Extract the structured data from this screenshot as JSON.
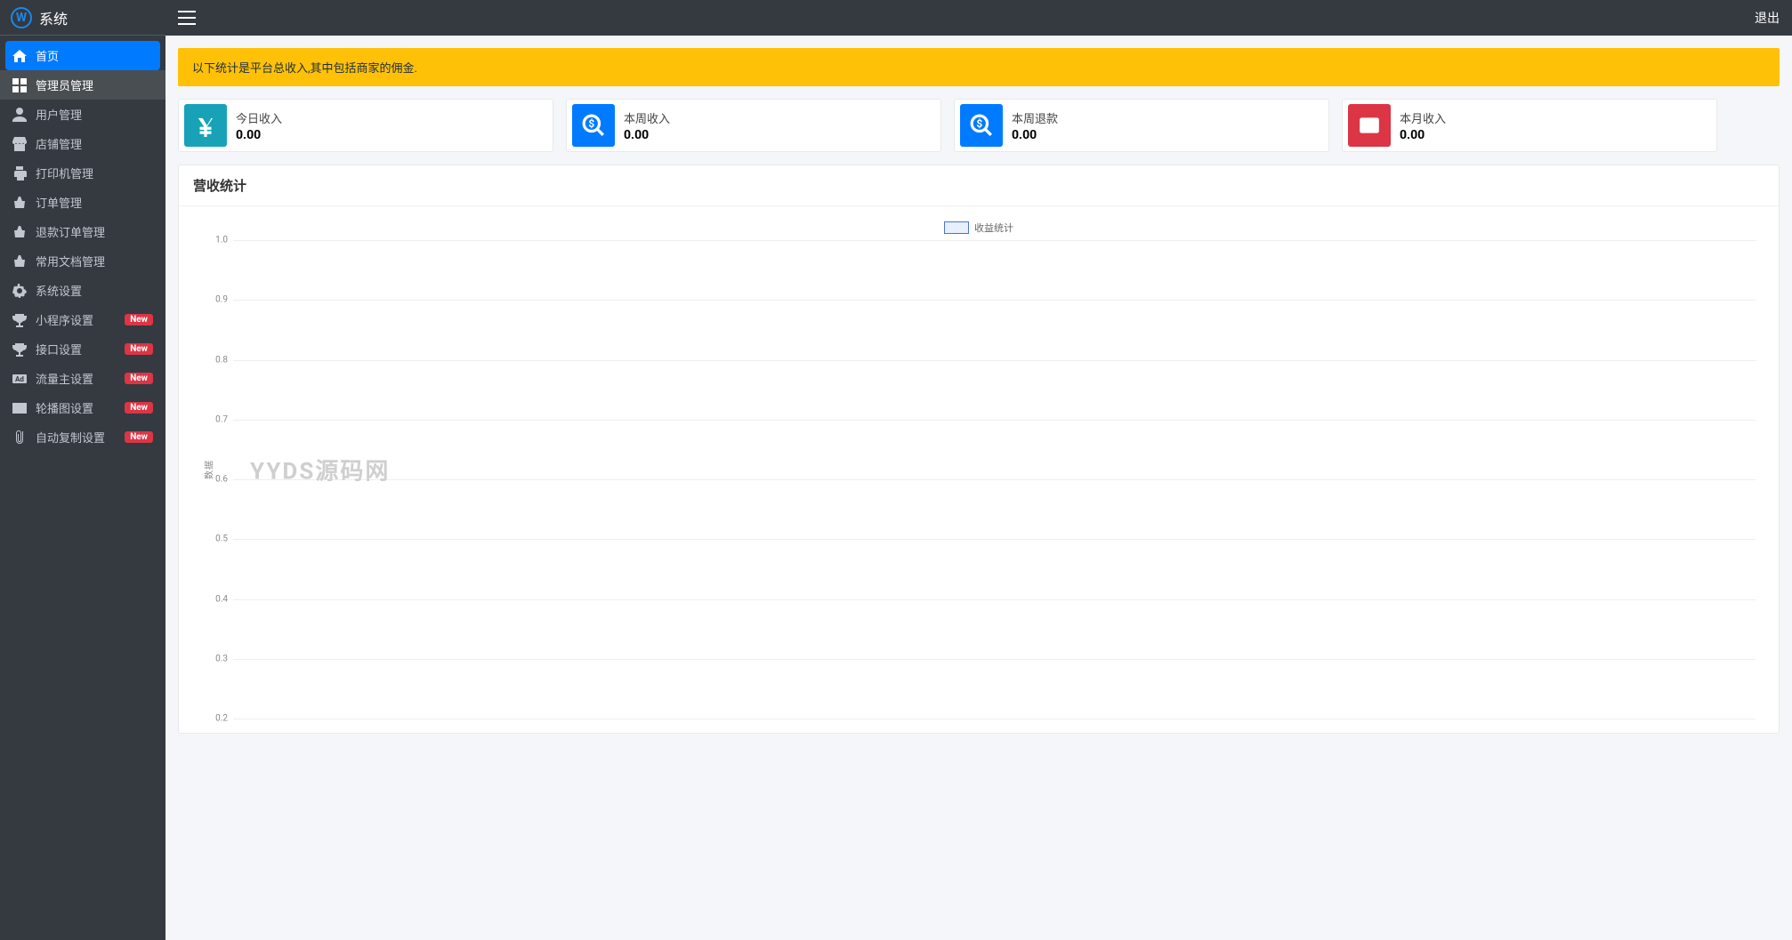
{
  "brand": {
    "logo_letter": "W",
    "title": "系统"
  },
  "topbar": {
    "logout": "退出"
  },
  "sidebar": {
    "items": [
      {
        "icon": "home",
        "label": "首页",
        "active": true
      },
      {
        "icon": "dashboard",
        "label": "管理员管理",
        "subactive": true
      },
      {
        "icon": "user",
        "label": "用户管理"
      },
      {
        "icon": "shop",
        "label": "店铺管理"
      },
      {
        "icon": "print",
        "label": "打印机管理"
      },
      {
        "icon": "basket",
        "label": "订单管理"
      },
      {
        "icon": "basket",
        "label": "退款订单管理"
      },
      {
        "icon": "basket",
        "label": "常用文档管理"
      },
      {
        "icon": "gear",
        "label": "系统设置"
      },
      {
        "icon": "trophy",
        "label": "小程序设置",
        "badge": "New"
      },
      {
        "icon": "trophy",
        "label": "接口设置",
        "badge": "New"
      },
      {
        "icon": "ad",
        "label": "流量主设置",
        "badge": "New"
      },
      {
        "icon": "image",
        "label": "轮播图设置",
        "badge": "New"
      },
      {
        "icon": "clip",
        "label": "自动复制设置",
        "badge": "New"
      }
    ]
  },
  "alert": {
    "text": "以下统计是平台总收入,其中包括商家的佣金."
  },
  "stats": [
    {
      "icon": "yen",
      "color": "teal",
      "label": "今日收入",
      "value": "0.00"
    },
    {
      "icon": "magnifier",
      "color": "blue",
      "label": "本周收入",
      "value": "0.00"
    },
    {
      "icon": "magnifier",
      "color": "blue",
      "label": "本周退款",
      "value": "0.00"
    },
    {
      "icon": "wallet",
      "color": "red",
      "label": "本月收入",
      "value": "0.00"
    }
  ],
  "chart_panel": {
    "title": "营收统计",
    "watermark": "YYDS源码网"
  },
  "chart_data": {
    "type": "line",
    "title": "营收统计",
    "xlabel": "",
    "ylabel": "数据",
    "ylim": [
      0.2,
      1.0
    ],
    "yticks": [
      1.0,
      0.9,
      0.8,
      0.7,
      0.6,
      0.5,
      0.4,
      0.3,
      0.2
    ],
    "series": [
      {
        "name": "收益统计",
        "values": [],
        "color": "#4876d2"
      }
    ],
    "x": [],
    "legend_position": "top-center",
    "grid": true
  }
}
